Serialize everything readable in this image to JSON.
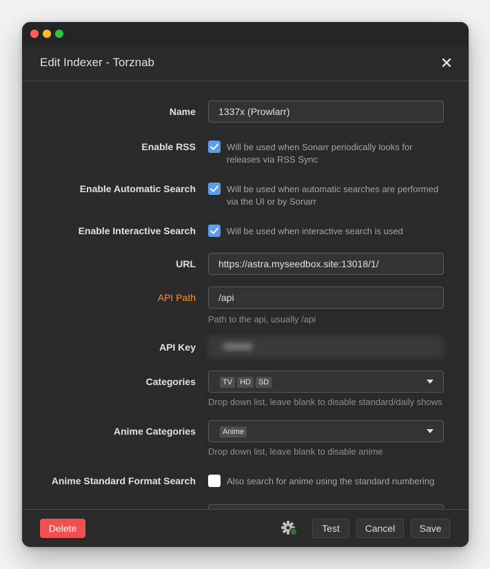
{
  "window": {
    "title": "Edit Indexer - Torznab"
  },
  "fields": {
    "name": {
      "label": "Name",
      "value": "1337x (Prowlarr)"
    },
    "enable_rss": {
      "label": "Enable RSS",
      "help": "Will be used when Sonarr periodically looks for releases via RSS Sync",
      "checked": true
    },
    "enable_auto": {
      "label": "Enable Automatic Search",
      "help": "Will be used when automatic searches are performed via the UI or by Sonarr",
      "checked": true
    },
    "enable_interactive": {
      "label": "Enable Interactive Search",
      "help": "Will be used when interactive search is used",
      "checked": true
    },
    "url": {
      "label": "URL",
      "value": "https://astra.myseedbox.site:13018/1/"
    },
    "api_path": {
      "label": "API Path",
      "value": "/api",
      "help": "Path to the api, usually /api"
    },
    "api_key": {
      "label": "API Key"
    },
    "categories": {
      "label": "Categories",
      "tags": [
        "TV",
        "HD",
        "SD"
      ],
      "help": "Drop down list, leave blank to disable standard/daily shows"
    },
    "anime_categories": {
      "label": "Anime Categories",
      "tags": [
        "Anime"
      ],
      "help": "Drop down list, leave blank to disable anime"
    },
    "anime_standard": {
      "label": "Anime Standard Format Search",
      "help": "Also search for anime using the standard numbering",
      "checked": false
    }
  },
  "footer": {
    "delete": "Delete",
    "test": "Test",
    "cancel": "Cancel",
    "save": "Save"
  },
  "colors": {
    "accent": "#5d9cec",
    "danger": "#f05050",
    "warning": "#ff902b"
  }
}
